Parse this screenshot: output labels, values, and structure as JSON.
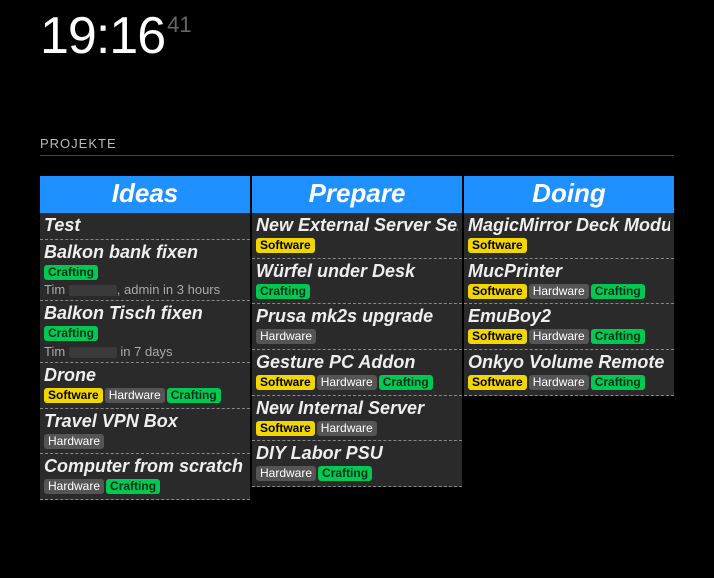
{
  "clock": {
    "time": "19:16",
    "seconds": "41"
  },
  "section_title": "PROJEKTE",
  "label_text": {
    "software": "Software",
    "hardware": "Hardware",
    "crafting": "Crafting"
  },
  "columns": [
    {
      "header": "Ideas",
      "cards": [
        {
          "title": "Test",
          "labels": []
        },
        {
          "title": "Balkon bank fixen",
          "labels": [
            "crafting"
          ],
          "meta_prefix": "Tim ",
          "meta_blur": true,
          "meta_suffix": ", admin in 3 hours"
        },
        {
          "title": "Balkon Tisch fixen",
          "labels": [
            "crafting"
          ],
          "meta_prefix": "Tim ",
          "meta_blur": true,
          "meta_suffix": " in 7 days"
        },
        {
          "title": "Drone",
          "labels": [
            "software",
            "hardware",
            "crafting"
          ]
        },
        {
          "title": "Travel VPN Box",
          "labels": [
            "hardware"
          ]
        },
        {
          "title": "Computer from scratch",
          "labels": [
            "hardware",
            "crafting"
          ]
        }
      ]
    },
    {
      "header": "Prepare",
      "cards": [
        {
          "title": "New External Server Server",
          "labels": [
            "software"
          ]
        },
        {
          "title": "Würfel under Desk",
          "labels": [
            "crafting"
          ]
        },
        {
          "title": "Prusa mk2s upgrade",
          "labels": [
            "hardware"
          ]
        },
        {
          "title": "Gesture PC Addon",
          "labels": [
            "software",
            "hardware",
            "crafting"
          ]
        },
        {
          "title": "New Internal Server",
          "labels": [
            "software",
            "hardware"
          ]
        },
        {
          "title": "DIY Labor PSU",
          "labels": [
            "hardware",
            "crafting"
          ]
        }
      ]
    },
    {
      "header": "Doing",
      "cards": [
        {
          "title": "MagicMirror Deck Module",
          "labels": [
            "software"
          ]
        },
        {
          "title": "MucPrinter",
          "labels": [
            "software",
            "hardware",
            "crafting"
          ]
        },
        {
          "title": "EmuBoy2",
          "labels": [
            "software",
            "hardware",
            "crafting"
          ]
        },
        {
          "title": "Onkyo Volume Remote",
          "labels": [
            "software",
            "hardware",
            "crafting"
          ]
        }
      ]
    }
  ]
}
